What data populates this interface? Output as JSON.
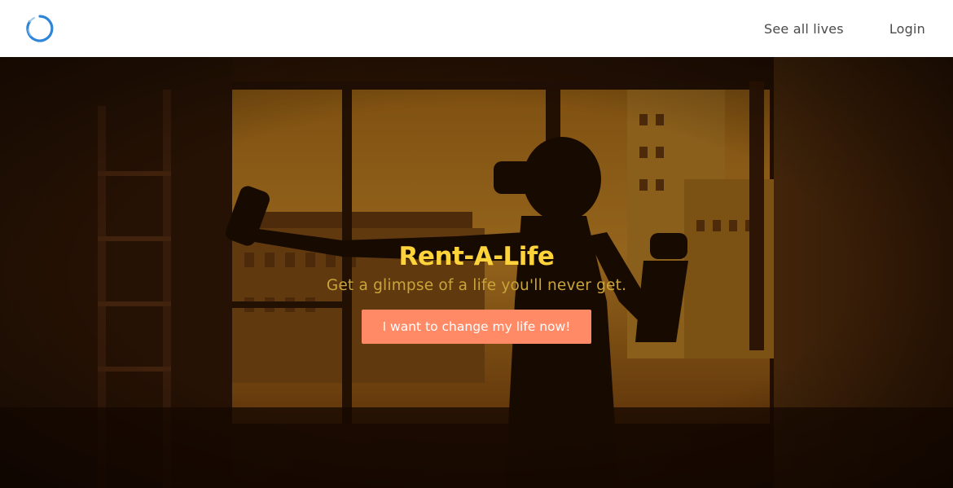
{
  "nav": {
    "logo_icon": "circle-swoosh-logo-icon",
    "links": [
      {
        "label": "See all lives"
      },
      {
        "label": "Login"
      }
    ]
  },
  "hero": {
    "title": "Rent-A-Life",
    "subtitle": "Get a glimpse of a life you'll never get.",
    "cta_label": "I want to change my life now!",
    "background_image": "silhouette-vr-headset-window-photo"
  },
  "colors": {
    "title": "#ffd43a",
    "subtitle": "#c9a43a",
    "cta_background": "#ff8a65",
    "nav_text": "#4a4a4a",
    "logo": "#2f86d6"
  }
}
